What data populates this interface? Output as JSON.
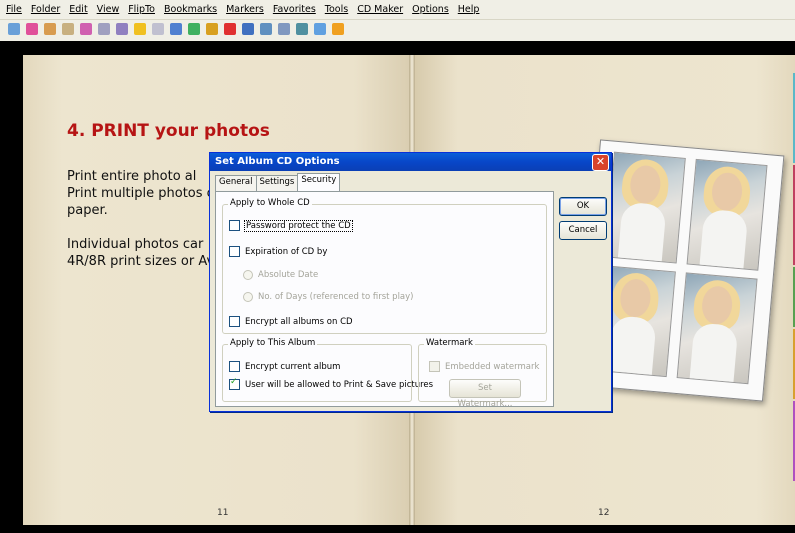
{
  "menu": [
    "File",
    "Folder",
    "Edit",
    "View",
    "FlipTo",
    "Bookmarks",
    "Markers",
    "Favorites",
    "Tools",
    "CD Maker",
    "Options",
    "Help"
  ],
  "toolbar_icons": [
    {
      "name": "eye-icon",
      "color": "#6aa0d8"
    },
    {
      "name": "bookmark-pink-icon",
      "color": "#e0509a"
    },
    {
      "name": "book-open-icon",
      "color": "#d89c50"
    },
    {
      "name": "book-icon",
      "color": "#c8b080"
    },
    {
      "name": "arrow-pink-icon",
      "color": "#d060b0"
    },
    {
      "name": "page-icon",
      "color": "#a0a0c0"
    },
    {
      "name": "print-icon",
      "color": "#9080c0"
    },
    {
      "name": "add-yellow-icon",
      "color": "#f0c020"
    },
    {
      "name": "flip-icon",
      "color": "#c0c0d0"
    },
    {
      "name": "columns-icon",
      "color": "#5080d0"
    },
    {
      "name": "tag-green-icon",
      "color": "#40b060"
    },
    {
      "name": "book-gold-icon",
      "color": "#d8a020"
    },
    {
      "name": "stop-red-icon",
      "color": "#e03030"
    },
    {
      "name": "nav-blue-icon",
      "color": "#4070c0"
    },
    {
      "name": "monitor-icon",
      "color": "#6090c0"
    },
    {
      "name": "grid-icon",
      "color": "#8098c0"
    },
    {
      "name": "album-icon",
      "color": "#5090a0"
    },
    {
      "name": "cursor-icon",
      "color": "#60a0e0"
    },
    {
      "name": "cd-icon",
      "color": "#f0a020"
    }
  ],
  "book": {
    "heading": "4. PRINT your photos",
    "line1": "Print entire photo al",
    "line2": "Print multiple photos c",
    "line3": "paper.",
    "line4": "Individual photos car",
    "line5": "4R/8R print sizes or Av",
    "left_page_number": "11",
    "right_page_number": "12"
  },
  "dialog": {
    "title": "Set Album CD Options",
    "tabs": [
      "General",
      "Settings",
      "Security"
    ],
    "active_tab": "Security",
    "whole_cd_group": "Apply to Whole CD",
    "password_label": "Password protect the CD",
    "password_checked": false,
    "expiration_label": "Expiration of CD by",
    "expiration_checked": false,
    "absolute_date_label": "Absolute Date",
    "days_label": "No. of Days (referenced to first play)",
    "encrypt_all_label": "Encrypt all albums on CD",
    "encrypt_all_checked": false,
    "album_group": "Apply to This Album",
    "encrypt_current_label": "Encrypt current album",
    "encrypt_current_checked": false,
    "print_save_label": "User will be allowed to Print & Save pictures",
    "print_save_checked": true,
    "watermark_group": "Watermark",
    "embedded_label": "Embedded watermark",
    "set_watermark_label": "Set Watermark...",
    "ok_label": "OK",
    "cancel_label": "Cancel",
    "close_label": "✕"
  },
  "colors": {
    "heading_red": "#b61414",
    "titlebar_blue": "#0846c8",
    "page_paper": "#ebe2cb"
  }
}
